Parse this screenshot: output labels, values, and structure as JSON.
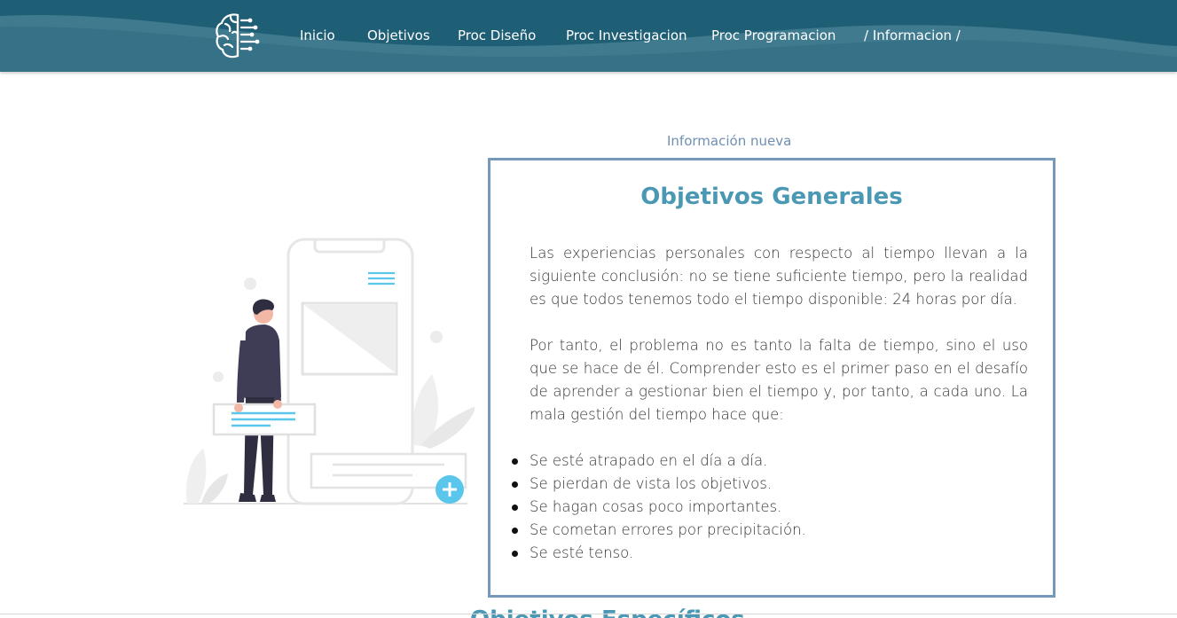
{
  "header": {
    "colors": {
      "bg": "#1f5f76",
      "wave": "#4a8396"
    },
    "logo_icon": "brain-circuit-icon",
    "nav": [
      {
        "label": "Inicio"
      },
      {
        "label": "Objetivos"
      },
      {
        "label": "Proc Diseño"
      },
      {
        "label": "Proc Investigacion"
      },
      {
        "label": "Proc Programacion"
      },
      {
        "label": "/ Informacion /"
      }
    ]
  },
  "section": {
    "label": "Información nueva"
  },
  "card": {
    "title": "Objetivos Generales",
    "paragraphs": [
      "Las experiencias personales con respecto al tiempo llevan a la siguiente conclusión: no se tiene suficiente tiempo, pero la realidad es que todos tenemos todo el tiempo disponible: 24 horas por día.",
      "Por tanto, el problema no es tanto la falta de tiempo, sino el uso que se hace de él. Comprender esto es el primer paso en el desafío de aprender a gestionar bien el tiempo y, por tanto, a cada uno. La mala gestión del tiempo hace que:"
    ],
    "bullets": [
      "Se esté atrapado en el día a día.",
      "Se pierdan de vista los objetivos.",
      "Se hagan cosas poco importantes.",
      "Se cometan errores por precipitación.",
      "Se esté tenso."
    ],
    "colors": {
      "border": "#7698bb",
      "title": "#4a98b3"
    }
  },
  "next_section": {
    "title": "Objetivos Específicos"
  },
  "illustration": {
    "icon": "person-with-phone-illustration",
    "accent": "#5bc6ec"
  }
}
